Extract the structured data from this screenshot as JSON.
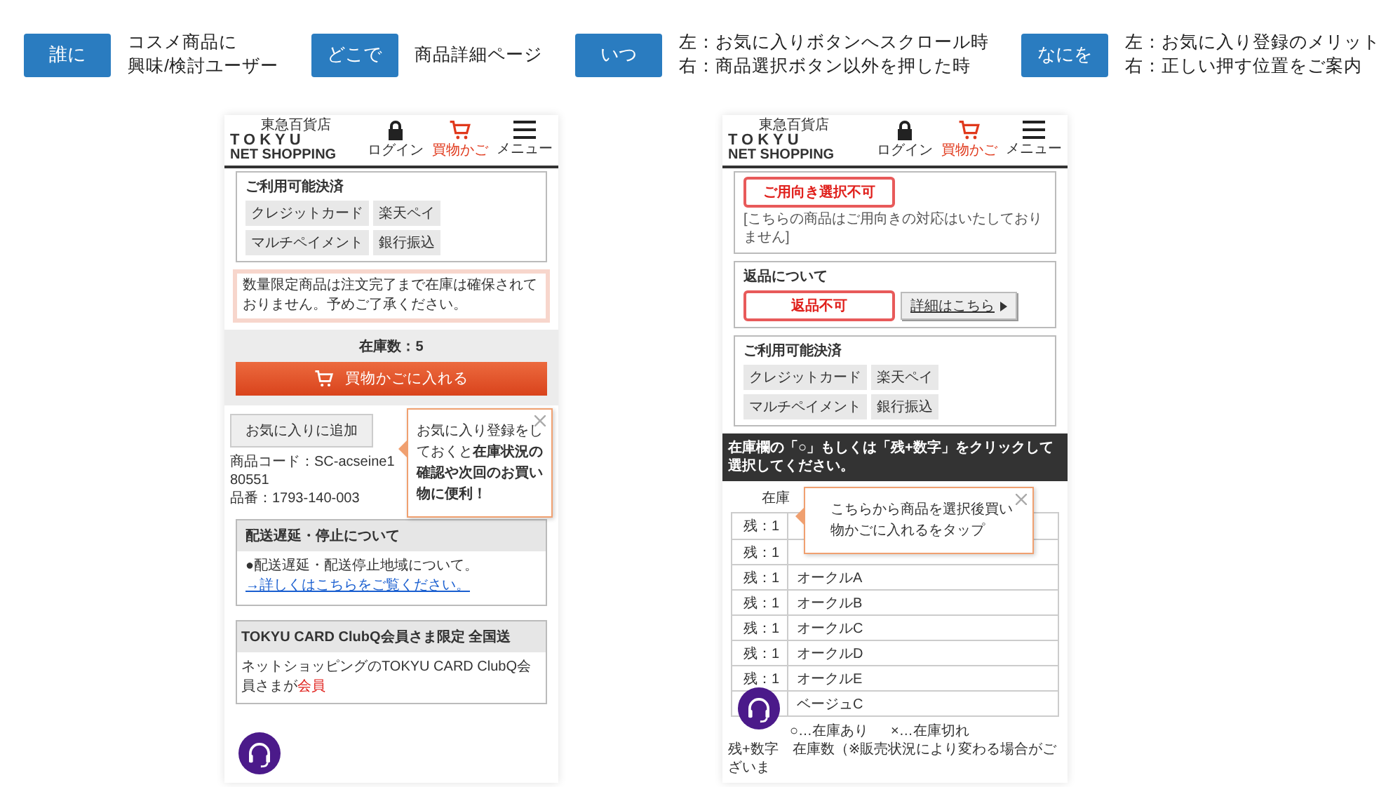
{
  "header_items": [
    {
      "badge": "誰に",
      "lines": [
        "コスメ商品に",
        "興味/検討ユーザー"
      ]
    },
    {
      "badge": "どこで",
      "lines": [
        "商品詳細ページ"
      ]
    },
    {
      "badge": "いつ",
      "lines": [
        "左：お気に入りボタンへスクロール時",
        "右：商品選択ボタン以外を押した時"
      ]
    },
    {
      "badge": "なにを",
      "lines": [
        "左：お気に入り登録のメリット",
        "右：正しい押す位置をご案内"
      ]
    }
  ],
  "phones": [
    {
      "logo": {
        "small": "東急百貨店",
        "brand": "TOKYU",
        "sub": "NET SHOPPING"
      },
      "nav": [
        {
          "kind": "lock",
          "label": "ログイン",
          "active": false
        },
        {
          "kind": "cart",
          "label": "買物かご",
          "active": true
        },
        {
          "kind": "menu",
          "label": "メニュー",
          "active": false
        }
      ],
      "sections": [
        {
          "kind": "payment",
          "title": "ご利用可能決済",
          "methods": [
            "クレジットカード",
            "楽天ペイ",
            "マルチペイメント",
            "銀行振込"
          ]
        },
        {
          "kind": "notice",
          "text": "数量限定商品は注文完了まで在庫は確保されておりません。予めご了承ください。"
        },
        {
          "kind": "stock_cart",
          "stock": "在庫数：5",
          "button": "買物かごに入れる"
        },
        {
          "kind": "favorite",
          "button": "お気に入りに追加",
          "lines": [
            "商品コード：SC-acseine180551",
            "品番：1793-140-003"
          ]
        },
        {
          "kind": "info_box",
          "title": "配送遅延・停止について",
          "text": "●配送遅延・配送停止地域について。",
          "link": "→詳しくはこちらをご覧ください。"
        },
        {
          "kind": "club",
          "title": "TOKYU CARD ClubQ会員さま限定 全国送",
          "text": "ネットショッピングのTOKYU CARD ClubQ会員さまが",
          "highlight": "会員"
        }
      ],
      "tooltip": {
        "text": "お気に入り登録をしておくと**在庫状況の確認や次回のお買い物に便利！**"
      }
    },
    {
      "logo": {
        "small": "東急百貨店",
        "brand": "TOKYU",
        "sub": "NET SHOPPING"
      },
      "nav": [
        {
          "kind": "lock",
          "label": "ログイン",
          "active": false
        },
        {
          "kind": "cart",
          "label": "買物かご",
          "active": true
        },
        {
          "kind": "menu",
          "label": "メニュー",
          "active": false
        }
      ],
      "sections": [
        {
          "kind": "restriction",
          "badge": "ご用向き選択不可",
          "text": "[こちらの商品はご用向きの対応はいたしておりません]"
        },
        {
          "kind": "returns",
          "title": "返品について",
          "badge": "返品不可",
          "button": "詳細はこちら"
        },
        {
          "kind": "payment",
          "title": "ご利用可能決済",
          "methods": [
            "クレジットカード",
            "楽天ペイ",
            "マルチペイメント",
            "銀行振込"
          ]
        },
        {
          "kind": "banner",
          "text": "在庫欄の「○」もしくは「残+数字」をクリックして選択してください。"
        },
        {
          "kind": "stock_table",
          "header": "在庫",
          "rows": [
            {
              "stock": "残：1"
            },
            {
              "stock": "残：1"
            },
            {
              "stock": "残：1",
              "shade": "オークルA"
            },
            {
              "stock": "残：1",
              "shade": "オークルB"
            },
            {
              "stock": "残：1",
              "shade": "オークルC"
            },
            {
              "stock": "残：1",
              "shade": "オークルD"
            },
            {
              "stock": "残：1",
              "shade": "オークルE"
            },
            {
              "shade": "ベージュC"
            }
          ],
          "legend": [
            "○…在庫あり",
            "×…在庫切れ"
          ],
          "note": "残+数字　在庫数（※販売状況により変わる場合がございま"
        }
      ],
      "tooltip": {
        "text": "こちらから商品を選択後買い物かごに入れるをタップ"
      }
    }
  ]
}
